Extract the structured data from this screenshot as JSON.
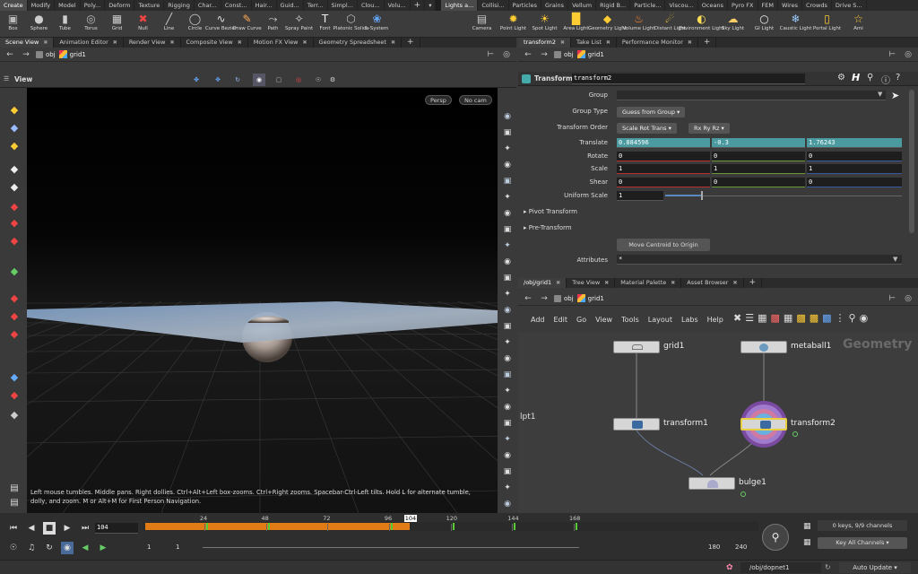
{
  "shelf_tabs_left": [
    "Create",
    "Modify",
    "Model",
    "Poly...",
    "Deform",
    "Texture",
    "Rigging",
    "Char...",
    "Const...",
    "Hair...",
    "Guid...",
    "Terr...",
    "Simpl...",
    "Clou...",
    "Volu..."
  ],
  "shelf_tabs_right": [
    "Lights a...",
    "Collisi...",
    "Particles",
    "Grains",
    "Vellum",
    "Rigid B...",
    "Particle...",
    "Viscou...",
    "Oceans",
    "Pyro FX",
    "FEM",
    "Wires",
    "Crowds",
    "Drive S..."
  ],
  "tools_left": [
    {
      "label": "Box",
      "icon": "box-icon"
    },
    {
      "label": "Sphere",
      "icon": "sphere-icon"
    },
    {
      "label": "Tube",
      "icon": "tube-icon"
    },
    {
      "label": "Torus",
      "icon": "torus-icon"
    },
    {
      "label": "Grid",
      "icon": "grid-icon"
    },
    {
      "label": "Null",
      "icon": "null-icon"
    },
    {
      "label": "Line",
      "icon": "line-icon"
    },
    {
      "label": "Circle",
      "icon": "circle-icon"
    },
    {
      "label": "Curve Bezier",
      "icon": "curve-bezier-icon"
    },
    {
      "label": "Draw Curve",
      "icon": "draw-curve-icon"
    },
    {
      "label": "Path",
      "icon": "path-icon"
    },
    {
      "label": "Spray Paint",
      "icon": "spray-paint-icon"
    },
    {
      "label": "Font",
      "icon": "font-icon"
    },
    {
      "label": "Platonic Solids",
      "icon": "platonic-solids-icon"
    },
    {
      "label": "L-System",
      "icon": "l-system-icon"
    }
  ],
  "tools_right": [
    {
      "label": "Camera",
      "icon": "camera-icon"
    },
    {
      "label": "Point Light",
      "icon": "point-light-icon"
    },
    {
      "label": "Spot Light",
      "icon": "spot-light-icon"
    },
    {
      "label": "Area Light",
      "icon": "area-light-icon"
    },
    {
      "label": "Geometry Light",
      "icon": "geometry-light-icon"
    },
    {
      "label": "Volume Light",
      "icon": "volume-light-icon"
    },
    {
      "label": "Distant Light",
      "icon": "distant-light-icon"
    },
    {
      "label": "Environment Light",
      "icon": "environment-light-icon"
    },
    {
      "label": "Sky Light",
      "icon": "sky-light-icon"
    },
    {
      "label": "GI Light",
      "icon": "gi-light-icon"
    },
    {
      "label": "Caustic Light",
      "icon": "caustic-light-icon"
    },
    {
      "label": "Portal Light",
      "icon": "portal-light-icon"
    },
    {
      "label": "Ami",
      "icon": "ambient-light-icon"
    }
  ],
  "left_pane_tabs": [
    "Scene View",
    "Animation Editor",
    "Render View",
    "Composite View",
    "Motion FX View",
    "Geometry Spreadsheet"
  ],
  "right_top_tabs": [
    "transform2",
    "Take List",
    "Performance Monitor"
  ],
  "right_bottom_tabs": [
    "/obj/grid1",
    "Tree View",
    "Material Palette",
    "Asset Browser"
  ],
  "path": {
    "obj": "obj",
    "node": "grid1"
  },
  "viewport": {
    "title": "View",
    "persp": "Persp",
    "cam": "No cam",
    "side_label": "lpt1",
    "help": "Left mouse tumbles. Middle pans. Right dollies. Ctrl+Alt+Left box-zooms. Ctrl+Right zooms. Spacebar-Ctrl-Left tilts. Hold L for alternate tumble, dolly, and zoom.    M or Alt+M for First Person Navigation."
  },
  "params": {
    "node_type": "Transform",
    "node_name": "transform2",
    "labels": {
      "group": "Group",
      "group_type": "Group Type",
      "order": "Transform Order",
      "translate": "Translate",
      "rotate": "Rotate",
      "scale": "Scale",
      "shear": "Shear",
      "uniform": "Uniform Scale",
      "attributes": "Attributes"
    },
    "group_type": "Guess from Group",
    "order_a": "Scale Rot Trans",
    "order_b": "Rx Ry Rz",
    "translate": [
      "0.884596",
      "-0.3",
      "1.76243"
    ],
    "rotate": [
      "0",
      "0",
      "0"
    ],
    "scale": [
      "1",
      "1",
      "1"
    ],
    "shear": [
      "0",
      "0",
      "0"
    ],
    "uniform": "1",
    "uniform_fraction": 0.15,
    "pivot": "Pivot Transform",
    "pre": "Pre-Transform",
    "centroid_btn": "Move Centroid to Origin",
    "attributes": "*"
  },
  "net": {
    "menu": [
      "Add",
      "Edit",
      "Go",
      "View",
      "Tools",
      "Layout",
      "Labs",
      "Help"
    ],
    "context": "Geometry",
    "nodes": {
      "grid1": "grid1",
      "metaball1": "metaball1",
      "transform1": "transform1",
      "transform2": "transform2",
      "bulge1": "bulge1"
    }
  },
  "timeline": {
    "ticks": [
      "24",
      "48",
      "72",
      "96",
      "120",
      "144",
      "168"
    ],
    "current": "104",
    "start": "1",
    "startb": "1",
    "end": "180",
    "endb": "240",
    "keys": "0 keys, 9/9 channels",
    "key_channels": "Key All Channels",
    "status_path": "/obj/dopnet1",
    "update": "Auto Update",
    "range_start": 1,
    "range_end": 240,
    "play_end": 180
  },
  "colors": {
    "accent": "#e07b16",
    "translate": "#4a9aa0",
    "rotate": "#b83030",
    "scale": "#6a9a3a",
    "shear": "#3a5aa0"
  }
}
